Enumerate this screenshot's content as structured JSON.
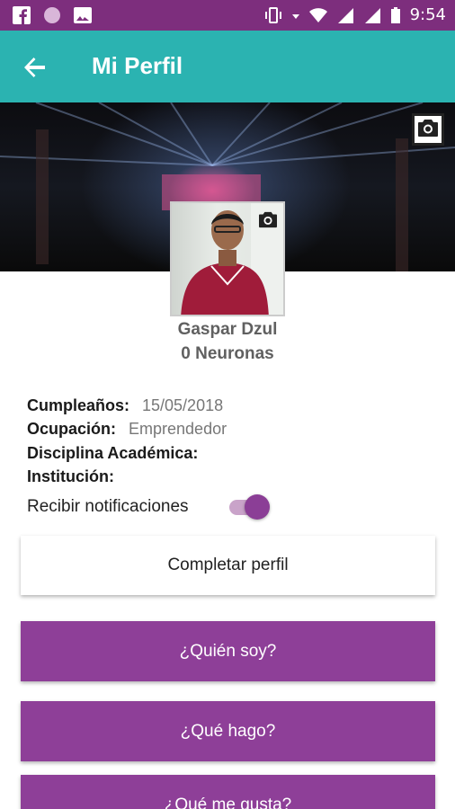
{
  "status_bar": {
    "time": "9:54",
    "left_icons": [
      "facebook-icon",
      "circle-icon",
      "image-icon"
    ],
    "right_icons": [
      "vibrate-icon",
      "data-arrows-icon",
      "wifi-icon",
      "signal-icon",
      "signal-icon",
      "battery-icon"
    ]
  },
  "app_bar": {
    "title": "Mi Perfil",
    "back_icon": "arrow-back-icon",
    "color": "#2bb3b1"
  },
  "profile": {
    "name": "Gaspar Dzul",
    "neurons": "0 Neuronas"
  },
  "info": {
    "birthday_label": "Cumpleaños:",
    "birthday_value": "15/05/2018",
    "occupation_label": "Ocupación:",
    "occupation_value": "Emprendedor",
    "discipline_label": "Disciplina Académica:",
    "institution_label": "Institución:"
  },
  "notifications": {
    "label": "Recibir notificaciones",
    "enabled": true
  },
  "buttons": {
    "complete_profile": "Completar perfil",
    "who_am_i": "¿Quién soy?",
    "what_i_do": "¿Qué hago?",
    "what_i_like": "¿Qué me gusta?"
  },
  "colors": {
    "status_bar": "#7d2e7d",
    "accent_purple": "#8e3f98",
    "teal": "#2bb3b1"
  }
}
